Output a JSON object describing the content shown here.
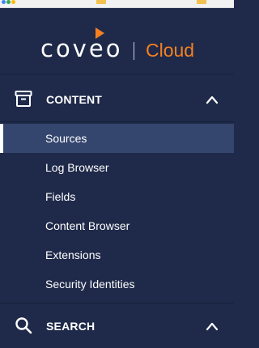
{
  "brand": {
    "logo_text": "coveo",
    "product": "Cloud",
    "accent_color": "#f58020",
    "bg_color": "#1f2a4a",
    "active_color": "#34456e"
  },
  "sections": [
    {
      "label": "CONTENT",
      "icon": "archive-box-icon",
      "expanded": true,
      "items": [
        {
          "label": "Sources",
          "active": true
        },
        {
          "label": "Log Browser",
          "active": false
        },
        {
          "label": "Fields",
          "active": false
        },
        {
          "label": "Content Browser",
          "active": false
        },
        {
          "label": "Extensions",
          "active": false
        },
        {
          "label": "Security Identities",
          "active": false
        }
      ]
    },
    {
      "label": "SEARCH",
      "icon": "search-icon",
      "expanded": true
    }
  ]
}
